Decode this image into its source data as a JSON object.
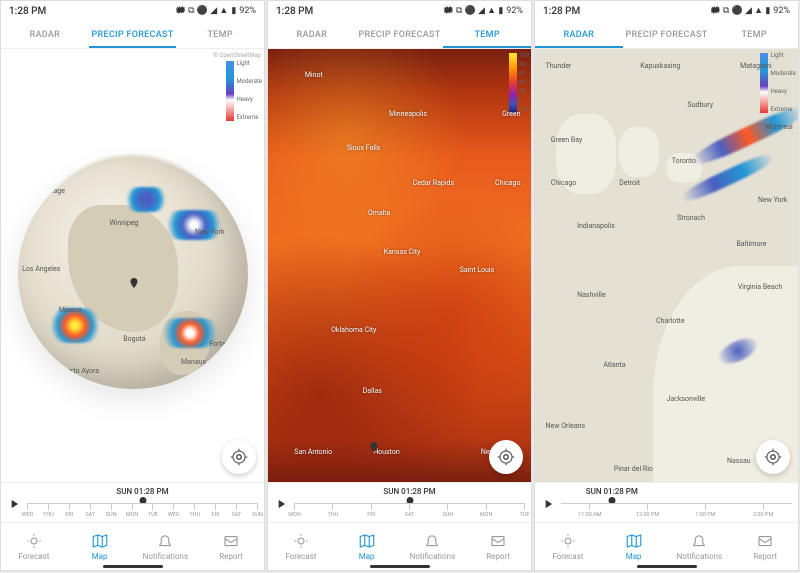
{
  "status": {
    "time": "1:28 PM",
    "battery": "92%",
    "nfc": "🗰",
    "bt": "⧉",
    "wifi": "◢",
    "sig": "▲"
  },
  "tabs": {
    "radar": "RADAR",
    "precip": "PRECIP FORECAST",
    "temp": "TEMP"
  },
  "screen1": {
    "active_tab": "precip",
    "attribution": "© OpenStreetMap",
    "legend": {
      "l0": "Light",
      "l1": "Moderate",
      "l2": "Heavy",
      "l3": "Extreme"
    },
    "cities": {
      "anchorage": "Anchorage",
      "winnipeg": "Winnipeg",
      "newyork": "New York",
      "la": "Los Angeles",
      "mexico": "México",
      "bogota": "Bogotá",
      "fortaleza": "Fortaleza",
      "manaus": "Manaus",
      "puerto": "Puerto Ayora"
    },
    "timeline_time": "SUN 01:28 PM",
    "ticks": [
      "WED",
      "THU",
      "FRI",
      "SAT",
      "SUN",
      "MON",
      "TUE",
      "WED",
      "THU",
      "FRI",
      "SAT",
      "SUN"
    ]
  },
  "screen2": {
    "active_tab": "temp",
    "legend": {
      "t0": "100",
      "t1": "80",
      "t2": "60",
      "t3": "40",
      "t4": "20",
      "t5": "0",
      "t6": "-20"
    },
    "cities": {
      "minot": "Minot",
      "mpls": "Minneapolis",
      "green": "Green",
      "sioux": "Sioux Falls",
      "cedar": "Cedar Rapids",
      "chicago": "Chicago",
      "omaha": "Omaha",
      "kc": "Kansas City",
      "stlouis": "Saint Louis",
      "okc": "Oklahoma City",
      "dallas": "Dallas",
      "sanantonio": "San Antonio",
      "houston": "Houston",
      "neworleans": "New Orleans"
    },
    "timeline_time": "SUN 01:28 PM",
    "ticks": [
      "MON",
      "THU",
      "FRI",
      "SAT",
      "SUN",
      "MON",
      "TUE"
    ]
  },
  "screen3": {
    "active_tab": "radar",
    "legend": {
      "l0": "Light",
      "l1": "Moderate",
      "l2": "Heavy",
      "l3": "Extreme"
    },
    "cities": {
      "thunder": "Thunder",
      "kapusk": "Kapuskasing",
      "matagami": "Matagami",
      "sudbury": "Sudbury",
      "montreal": "Montreal",
      "greenbay": "Green Bay",
      "toronto": "Toronto",
      "chicago": "Chicago",
      "detroit": "Detroit",
      "newyork": "New York",
      "indianapolis": "Indianapolis",
      "stronach": "Stronach",
      "baltimore": "Baltimore",
      "virginiabeach": "Virginia Beach",
      "nashville": "Nashville",
      "charlotte": "Charlotte",
      "atlanta": "Atlanta",
      "jacksonville": "Jacksonville",
      "neworleans": "New Orleans",
      "nassau": "Nassau",
      "pinar": "Pinar del Rio"
    },
    "timeline_time": "SUN 01:28 PM",
    "ticks": [
      "11:00 AM",
      "12:00 PM",
      "1:00 PM",
      "2:00 PM"
    ]
  },
  "nav": {
    "forecast": "Forecast",
    "map": "Map",
    "notifications": "Notifications",
    "report": "Report"
  }
}
